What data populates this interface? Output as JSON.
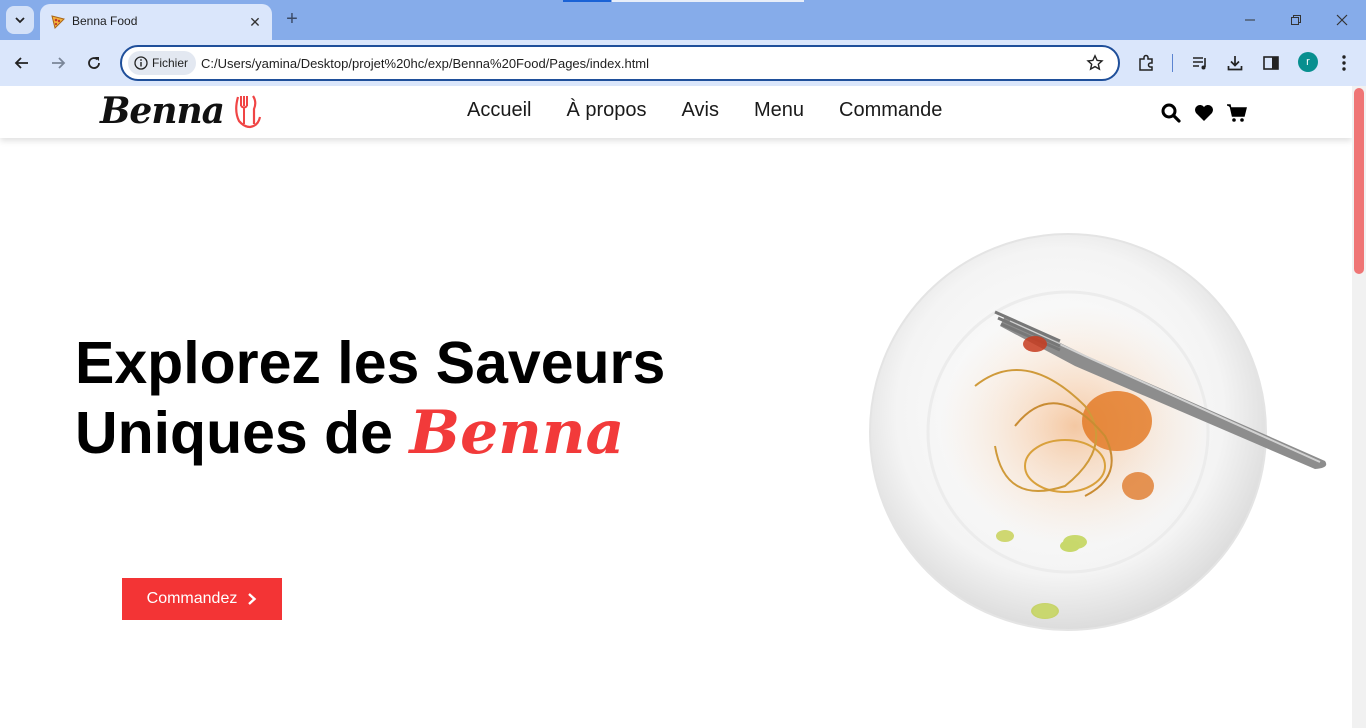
{
  "browser": {
    "tab_title": "Benna Food",
    "site_chip": "Fichier",
    "url": "C:/Users/yamina/Desktop/projet%20hc/exp/Benna%20Food/Pages/index.html",
    "profile_initial": "r"
  },
  "header": {
    "logo_text": "Benna",
    "nav": [
      "Accueil",
      "À propos",
      "Avis",
      "Menu",
      "Commande"
    ]
  },
  "hero": {
    "title_line1": "Explorez les Saveurs",
    "title_line2_prefix": "Uniques de ",
    "title_brand": "Benna",
    "cta_label": "Commandez"
  },
  "colors": {
    "accent": "#f33435",
    "chrome": "#86acea"
  }
}
